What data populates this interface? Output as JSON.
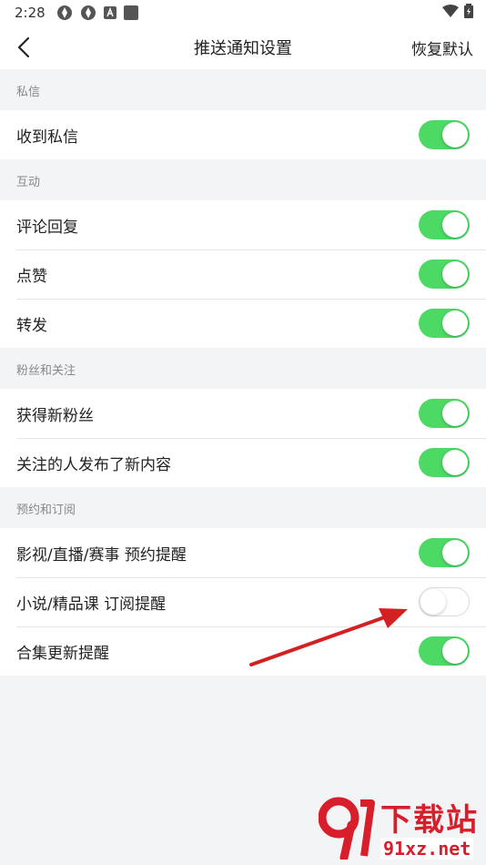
{
  "status_bar": {
    "time": "2:28"
  },
  "header": {
    "title": "推送通知设置",
    "reset_label": "恢复默认"
  },
  "sections": [
    {
      "title": "私信",
      "items": [
        {
          "label": "收到私信",
          "enabled": true
        }
      ]
    },
    {
      "title": "互动",
      "items": [
        {
          "label": "评论回复",
          "enabled": true
        },
        {
          "label": "点赞",
          "enabled": true
        },
        {
          "label": "转发",
          "enabled": true
        }
      ]
    },
    {
      "title": "粉丝和关注",
      "items": [
        {
          "label": "获得新粉丝",
          "enabled": true
        },
        {
          "label": "关注的人发布了新内容",
          "enabled": true
        }
      ]
    },
    {
      "title": "预约和订阅",
      "items": [
        {
          "label": "影视/直播/赛事 预约提醒",
          "enabled": true
        },
        {
          "label": "小说/精品课 订阅提醒",
          "enabled": false
        },
        {
          "label": "合集更新提醒",
          "enabled": true
        }
      ]
    }
  ],
  "watermark": {
    "title": "下载站",
    "url": "91xz.net"
  },
  "colors": {
    "toggle_on": "#4cd964",
    "background": "#f3f4f6",
    "arrow": "#d42020"
  }
}
